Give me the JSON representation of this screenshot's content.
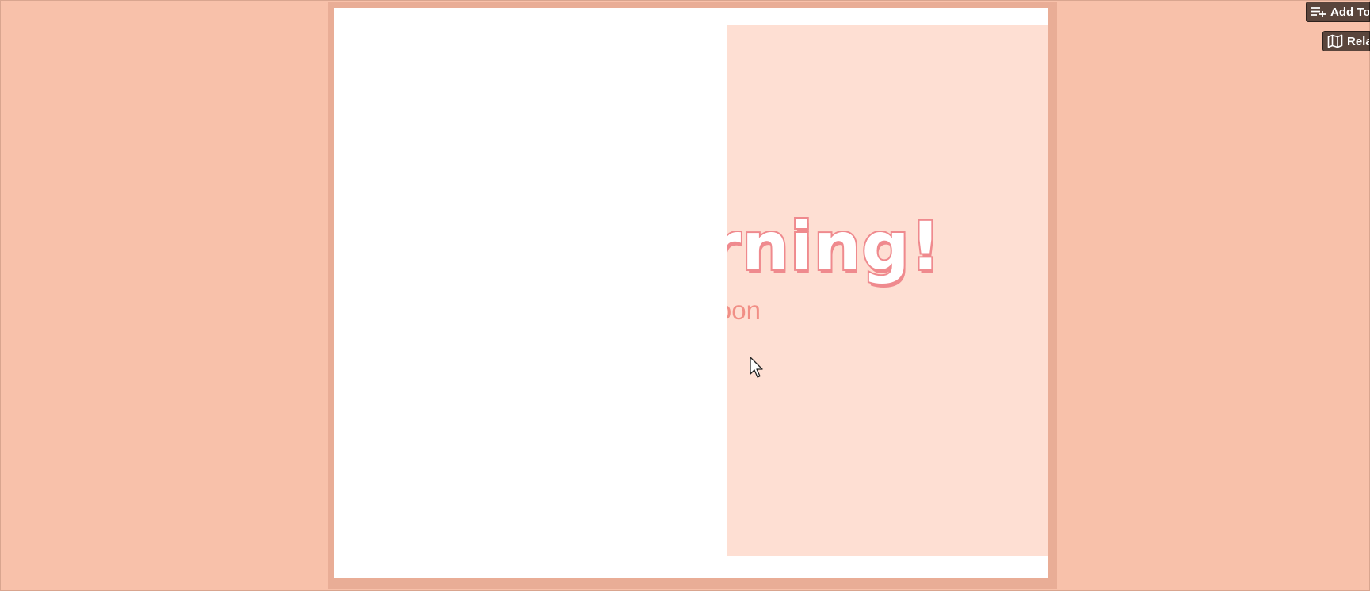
{
  "slide": {
    "title": "Good Morning!",
    "subtitle": "Good Afternoon"
  },
  "toolbar": {
    "add_topic_label": "Add Topic",
    "related_label": "Related"
  },
  "icons": {
    "add_topic": "playlist-add-icon",
    "related": "map-icon",
    "cursor": "mouse-pointer-icon"
  },
  "colors": {
    "background": "#f8c1aa",
    "frame": "#e9ad96",
    "panel": "#fedfd3",
    "title_outline": "#ef8a8e",
    "subtitle": "#f18f86",
    "button": "#5a453c"
  }
}
